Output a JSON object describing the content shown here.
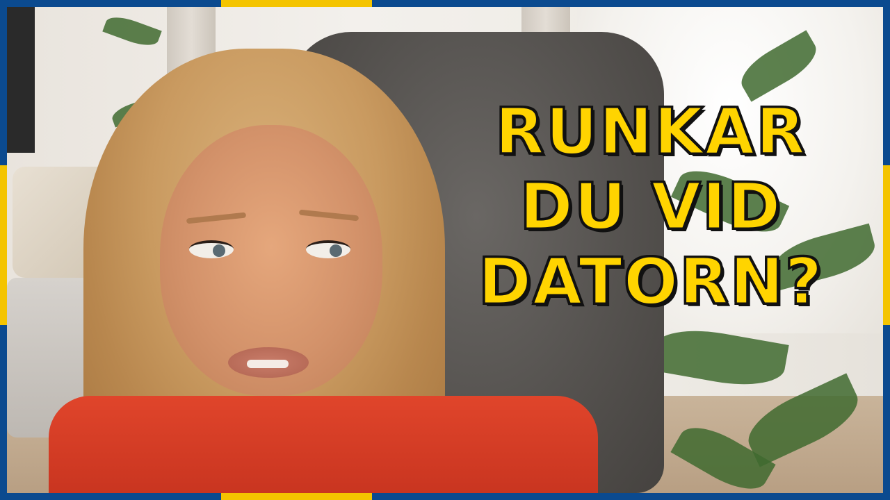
{
  "headline": {
    "line1": "RUNKAR",
    "line2": "DU VID",
    "line3": "DATORN?"
  },
  "colors": {
    "headline_text": "#ffd400",
    "border_blue": "#0b4a8f",
    "border_yellow": "#f4c400"
  }
}
